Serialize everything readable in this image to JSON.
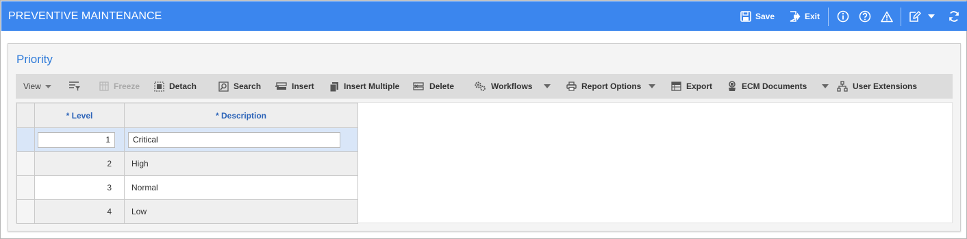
{
  "app": {
    "title": "PREVENTIVE MAINTENANCE"
  },
  "topbar": {
    "save_label": "Save",
    "exit_label": "Exit",
    "icons": [
      "info-icon",
      "help-icon",
      "warning-icon",
      "edit-note-icon",
      "caret-down-icon",
      "refresh-icon"
    ]
  },
  "panel": {
    "title": "Priority"
  },
  "toolbar": {
    "view_label": "View",
    "freeze_label": "Freeze",
    "detach_label": "Detach",
    "search_label": "Search",
    "insert_label": "Insert",
    "insert_multiple_label": "Insert Multiple",
    "delete_label": "Delete",
    "workflows_label": "Workflows",
    "report_options_label": "Report Options",
    "export_label": "Export",
    "ecm_documents_label": "ECM Documents",
    "user_extensions_label": "User Extensions"
  },
  "grid": {
    "columns": {
      "level": "* Level",
      "description": "* Description"
    },
    "rows": [
      {
        "level": "1",
        "description": "Critical"
      },
      {
        "level": "2",
        "description": "High"
      },
      {
        "level": "3",
        "description": "Normal"
      },
      {
        "level": "4",
        "description": "Low"
      }
    ]
  },
  "colors": {
    "topbar": "#3b86ee",
    "title": "#2f7bd9",
    "header_text": "#2b63b8",
    "active_row": "#d9e6f8"
  }
}
